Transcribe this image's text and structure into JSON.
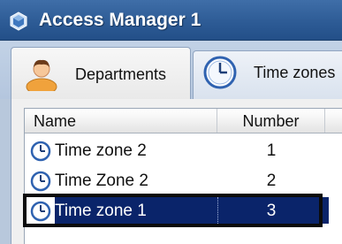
{
  "window": {
    "title": "Access Manager 1"
  },
  "tabs": [
    {
      "label": "Departments",
      "icon": "user-icon",
      "active": true
    },
    {
      "label": "Time zones",
      "icon": "clock-icon",
      "active": false
    }
  ],
  "list": {
    "columns": [
      "Name",
      "Number"
    ],
    "rows": [
      {
        "name": "Time zone 2",
        "number": "1",
        "selected": false
      },
      {
        "name": "Time Zone 2",
        "number": "2",
        "selected": false
      },
      {
        "name": "Time zone 1",
        "number": "3",
        "selected": true
      }
    ]
  },
  "colors": {
    "titlebar": "#2c5a94",
    "selection": "#0a246a",
    "highlight_frame": "#0b0b0b"
  }
}
